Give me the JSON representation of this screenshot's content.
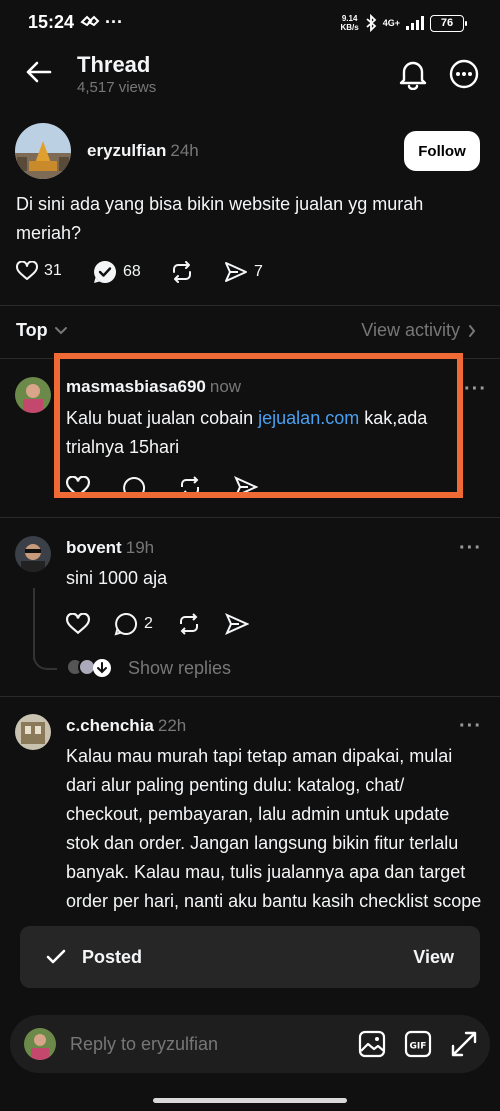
{
  "status_bar": {
    "time": "15:24",
    "net_speed_value": "9.14",
    "net_speed_unit": "KB/s",
    "signal": "4G+",
    "battery": "76"
  },
  "header": {
    "title": "Thread",
    "views": "4,517 views"
  },
  "post": {
    "username": "eryzulfian",
    "time": "24h",
    "follow_label": "Follow",
    "text": "Di sini ada yang bisa bikin website jualan yg murah meriah?",
    "likes": "31",
    "comments": "68",
    "shares": "7"
  },
  "sort": {
    "label": "Top",
    "view_activity": "View activity"
  },
  "replies": [
    {
      "username": "masmasbiasa690",
      "time": "now",
      "text_before": "Kalu buat jualan cobain ",
      "link": "jejualan.com",
      "text_after": " kak,ada trialnya 15hari"
    },
    {
      "username": "bovent",
      "time": "19h",
      "text": "sini 1000 aja",
      "comments": "2",
      "show_replies": "Show replies"
    },
    {
      "username": "c.chenchia",
      "time": "22h",
      "text": "Kalau mau murah tapi tetap aman dipakai, mulai dari alur paling penting dulu: katalog, chat/ checkout, pembayaran, lalu admin untuk update stok dan order. Jangan langsung bikin fitur terlalu banyak. Kalau mau, tulis jualannya apa dan target order per hari, nanti aku bantu kasih checklist scope biar gampang bandingin penawaran."
    }
  ],
  "toast": {
    "label": "Posted",
    "action": "View"
  },
  "reply_bar": {
    "placeholder": "Reply to eryzulfian"
  },
  "colors": {
    "background": "#101010",
    "link": "#4aa0f0",
    "highlight": "#f06a35",
    "verified": "#ffffff"
  }
}
